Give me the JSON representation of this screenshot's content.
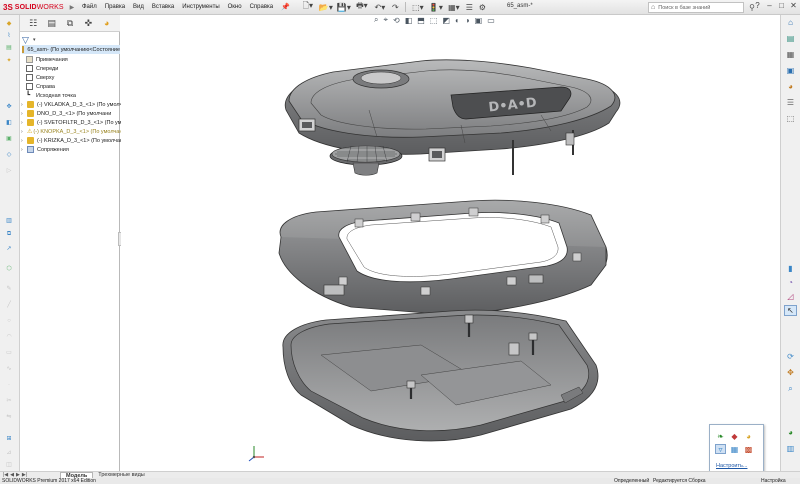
{
  "app": {
    "brand_ds": "3S",
    "brand_solid": "SOLID",
    "brand_works": "WORKS",
    "document_title": "65_asm-*",
    "menus": [
      "Файл",
      "Правка",
      "Вид",
      "Вставка",
      "Инструменты",
      "Окно",
      "Справка"
    ],
    "search_placeholder": "Поиск в базе знаний",
    "window_controls": [
      "?",
      "–",
      "□",
      "✕"
    ]
  },
  "feature_tree": {
    "root": "65_asm- (По умолчанию<Состояние",
    "items": [
      {
        "label": "Примечания",
        "kind": "folder"
      },
      {
        "label": "Спереди",
        "kind": "plane"
      },
      {
        "label": "Сверху",
        "kind": "plane"
      },
      {
        "label": "Справа",
        "kind": "plane"
      },
      {
        "label": "Исходная точка",
        "kind": "origin"
      },
      {
        "label": "(-) VKLADKA_D_3_<1> (По умолчан",
        "kind": "part"
      },
      {
        "label": "DNO_D_3_<1> (По умолчани",
        "kind": "part"
      },
      {
        "label": "(-) SVETOFILTR_D_3_<1> (По умолчани",
        "kind": "part"
      },
      {
        "label": "(-) KNOPKA_D_3_<1> (По умолчан",
        "kind": "part-warn"
      },
      {
        "label": "(-) KRIZKA_D_3_<1> (По умолчан",
        "kind": "part"
      },
      {
        "label": "Сопряжения",
        "kind": "mate"
      }
    ]
  },
  "bottom_tabs": {
    "model": "Модель",
    "motion": "Трехмерные виды"
  },
  "status": {
    "product": "SOLIDWORKS Premium 2017 x64 Edition",
    "defined": "Определенный",
    "editing": "Редактируется Сборка",
    "config": "Настройка"
  },
  "popup": {
    "customize_link": "Настроить..."
  },
  "colors": {
    "brand_red": "#d6001c",
    "selection_blue": "#d5e7f8",
    "model_gray": "#8f9091"
  }
}
